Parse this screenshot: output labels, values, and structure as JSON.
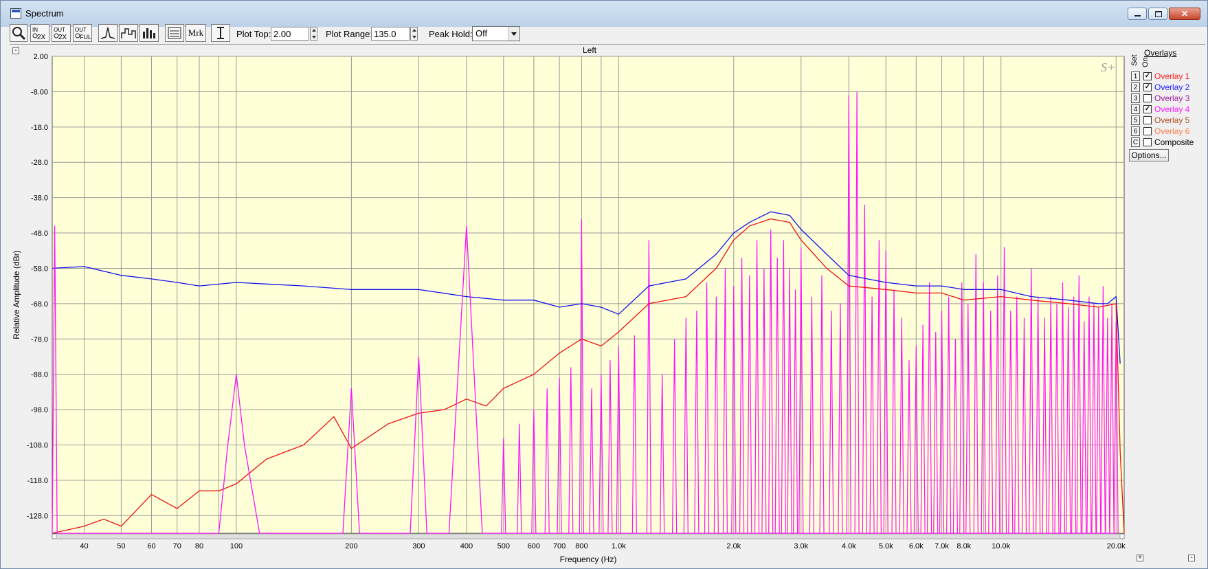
{
  "window": {
    "title": "Spectrum"
  },
  "toolbar": {
    "plot_top_label": "Plot Top:",
    "plot_top_value": "2.00",
    "plot_range_label": "Plot Range:",
    "plot_range_value": "135.0",
    "peak_hold_label": "Peak Hold:",
    "peak_hold_value": "Off",
    "marker_label": "Mrk"
  },
  "overlays": {
    "header": "Overlays",
    "set_label": "Set",
    "on_label": "On",
    "options_button": "Options...",
    "items": [
      {
        "set": "1",
        "name": "Overlay 1",
        "on": true,
        "color": "#ff2020"
      },
      {
        "set": "2",
        "name": "Overlay 2",
        "on": true,
        "color": "#2020ff"
      },
      {
        "set": "3",
        "name": "Overlay 3",
        "on": false,
        "color": "#a020a0"
      },
      {
        "set": "4",
        "name": "Overlay 4",
        "on": true,
        "color": "#ff20ff"
      },
      {
        "set": "5",
        "name": "Overlay 5",
        "on": false,
        "color": "#b05020"
      },
      {
        "set": "6",
        "name": "Overlay 6",
        "on": false,
        "color": "#ff8050"
      },
      {
        "set": "C",
        "name": "Composite",
        "on": false,
        "color": "#000000"
      }
    ]
  },
  "chart_data": {
    "type": "line",
    "title": "Left",
    "watermark": "S+",
    "xlabel": "Frequency (Hz)",
    "ylabel": "Relative Amplitude (dBr)",
    "xscale": "log",
    "xlim": [
      33,
      21000
    ],
    "ylim": [
      -133,
      2
    ],
    "grid": true,
    "background": "#ffffd8",
    "y_ticks": [
      2.0,
      -8.0,
      -18.0,
      -28.0,
      -38.0,
      -48.0,
      -58.0,
      -68.0,
      -78.0,
      -88.0,
      -98.0,
      -108.0,
      -118.0,
      -128.0
    ],
    "y_tick_labels": [
      "2.00",
      "-8.00",
      "-18.0",
      "-28.0",
      "-38.0",
      "-48.0",
      "-58.0",
      "-68.0",
      "-78.0",
      "-88.0",
      "-98.0",
      "-108.0",
      "-118.0",
      "-128.0"
    ],
    "x_ticks": [
      40,
      50,
      60,
      70,
      80,
      100,
      200,
      300,
      400,
      500,
      600,
      700,
      800,
      1000,
      2000,
      3000,
      4000,
      5000,
      6000,
      7000,
      8000,
      10000,
      20000
    ],
    "x_tick_labels": [
      "40",
      "50",
      "60",
      "70",
      "80",
      "100",
      "200",
      "300",
      "400",
      "500",
      "600",
      "700",
      "800",
      "1.0k",
      "2.0k",
      "3.0k",
      "4.0k",
      "5.0k",
      "6.0k",
      "7.0k",
      "8.0k",
      "10.0k",
      "20.0k"
    ],
    "series": [
      {
        "name": "Overlay 2",
        "color": "#1010ee",
        "x": [
          33,
          40,
          50,
          60,
          70,
          80,
          100,
          150,
          200,
          300,
          400,
          500,
          600,
          700,
          800,
          900,
          1000,
          1200,
          1500,
          1800,
          2000,
          2200,
          2500,
          2800,
          3000,
          3500,
          4000,
          5000,
          6000,
          7000,
          8000,
          10000,
          12000,
          15000,
          18000,
          19000,
          20000,
          20500
        ],
        "y": [
          -58,
          -57.5,
          -60,
          -61,
          -62,
          -63,
          -62,
          -63,
          -64,
          -64,
          -66,
          -67,
          -67,
          -69,
          -68,
          -69,
          -71,
          -63,
          -61,
          -54,
          -48,
          -45,
          -42,
          -43,
          -47,
          -54,
          -60,
          -62,
          -63,
          -63,
          -64,
          -64,
          -66,
          -67,
          -68,
          -68,
          -66,
          -85
        ]
      },
      {
        "name": "Overlay 1",
        "color": "#ee1010",
        "x": [
          33,
          40,
          45,
          50,
          60,
          70,
          80,
          90,
          100,
          120,
          150,
          180,
          200,
          250,
          300,
          350,
          400,
          450,
          500,
          600,
          700,
          800,
          900,
          1000,
          1200,
          1500,
          1800,
          2000,
          2200,
          2500,
          2800,
          3000,
          3500,
          4000,
          5000,
          6000,
          7000,
          8000,
          10000,
          12000,
          15000,
          18000,
          20000,
          20500,
          21000
        ],
        "y": [
          -133,
          -131,
          -129,
          -131,
          -122,
          -126,
          -121,
          -121,
          -119,
          -112,
          -108,
          -100,
          -109,
          -102,
          -99,
          -98,
          -95,
          -97,
          -92,
          -88,
          -82,
          -78,
          -80,
          -76,
          -68,
          -66,
          -58,
          -50,
          -46,
          -44,
          -45,
          -50,
          -58,
          -63,
          -64,
          -65,
          -65,
          -67,
          -66,
          -67,
          -68,
          -69,
          -68,
          -110,
          -133
        ]
      },
      {
        "name": "Overlay 4",
        "color": "#ff10ff",
        "x": [
          33,
          33.5,
          34,
          90,
          95,
          100,
          105,
          115,
          190,
          200,
          210,
          285,
          300,
          315,
          360,
          400,
          440,
          500,
          600,
          700,
          800,
          900,
          1000,
          1500,
          2000,
          3000,
          4000,
          4500,
          5000,
          7000,
          10000,
          15000,
          20000
        ],
        "y": [
          -133,
          -46,
          -133,
          -133,
          -108,
          -88,
          -108,
          -133,
          -133,
          -92,
          -133,
          -133,
          -83,
          -133,
          -133,
          -46,
          -133,
          -133,
          -133,
          -133,
          -133,
          -133,
          -133,
          -133,
          -133,
          -133,
          -133,
          -133,
          -133,
          -133,
          -133,
          -133,
          -133
        ]
      }
    ],
    "spikes": {
      "series": "Overlay 4",
      "color": "#ff10ff",
      "baseline": -133,
      "frequencies": [
        500,
        550,
        600,
        650,
        700,
        750,
        800,
        850,
        900,
        950,
        1000,
        1100,
        1200,
        1300,
        1400,
        1500,
        1600,
        1700,
        1800,
        1900,
        2000,
        2100,
        2200,
        2300,
        2400,
        2500,
        2600,
        2700,
        2800,
        2900,
        3000,
        3200,
        3400,
        3600,
        3800,
        4000,
        4200,
        4400,
        4600,
        4800,
        5000,
        5250,
        5500,
        5750,
        6000,
        6250,
        6500,
        6750,
        7000,
        7300,
        7600,
        7900,
        8200,
        8600,
        9000,
        9400,
        9800,
        10200,
        10600,
        11000,
        11500,
        12000,
        12500,
        13000,
        13500,
        14000,
        14500,
        15000,
        15500,
        16000,
        16500,
        17000,
        17500,
        18000,
        18500,
        19000,
        19500,
        20000
      ],
      "peaks": [
        -106,
        -102,
        -98,
        -92,
        -89,
        -86,
        -44,
        -92,
        -88,
        -84,
        -80,
        -77,
        -50,
        -88,
        -78,
        -72,
        -70,
        -62,
        -66,
        -58,
        -63,
        -55,
        -60,
        -50,
        -58,
        -47,
        -55,
        -50,
        -58,
        -64,
        -52,
        -66,
        -60,
        -70,
        -68,
        -9,
        -8,
        -40,
        -66,
        -50,
        -53,
        -64,
        -72,
        -84,
        -80,
        -74,
        -62,
        -76,
        -70,
        -66,
        -78,
        -62,
        -68,
        -54,
        -62,
        -70,
        -60,
        -52,
        -70,
        -66,
        -72,
        -58,
        -66,
        -72,
        -66,
        -68,
        -62,
        -69,
        -66,
        -60,
        -73,
        -66,
        -68,
        -69,
        -63,
        -72,
        -68,
        -73
      ]
    }
  }
}
